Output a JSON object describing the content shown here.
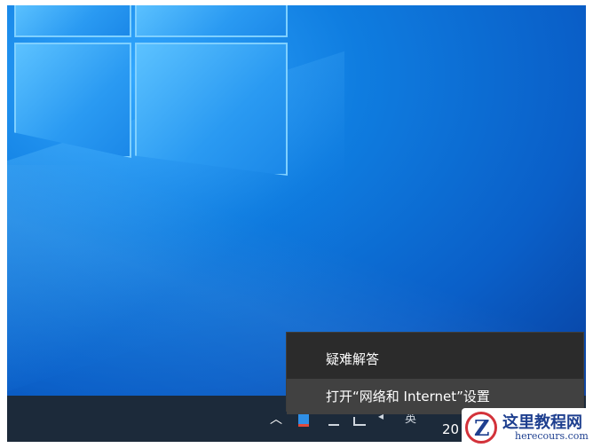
{
  "context_menu": {
    "items": [
      {
        "label": "疑难解答"
      },
      {
        "label": "打开“网络和 Internet”设置"
      }
    ]
  },
  "taskbar": {
    "clock_partial": "20"
  },
  "watermark": {
    "title": "这里教程网",
    "url": "herecours.com"
  },
  "colors": {
    "desktop": "#0a5fc8",
    "taskbar": "#1c2a3a",
    "menu": "#2b2b2b",
    "menu_hover": "#414141"
  }
}
